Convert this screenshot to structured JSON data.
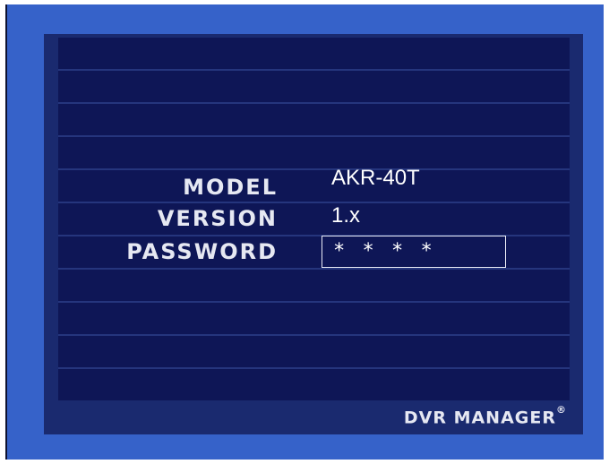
{
  "login": {
    "model_label": "MODEL",
    "model_value": "AKR-40T",
    "version_label": "VERSION",
    "version_value": "1.x",
    "password_label": "PASSWORD",
    "password_value": "* * * *"
  },
  "footer": {
    "brand": "DVR MANAGER",
    "registered_mark": "®"
  },
  "colors": {
    "frame": "#3662c9",
    "panel": "#1a2a6f",
    "display": "#0e1656",
    "text": "#e6e8f2"
  }
}
